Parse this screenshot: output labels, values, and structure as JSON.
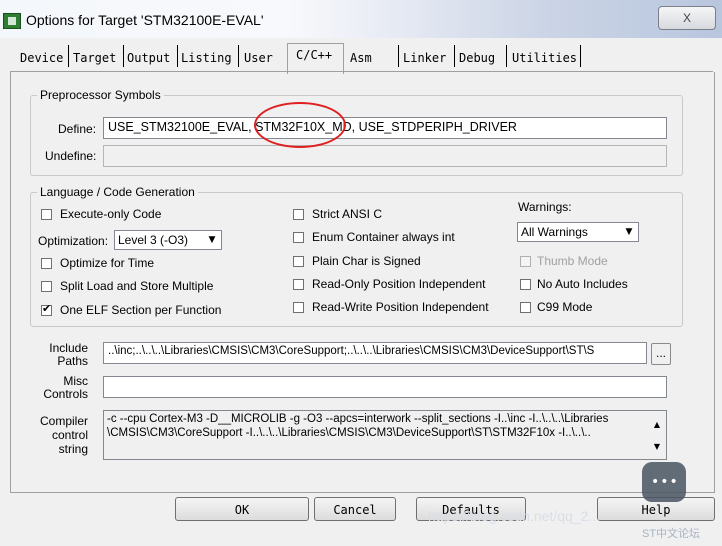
{
  "window": {
    "title": "Options for Target 'STM32100E-EVAL'",
    "close_label": "X"
  },
  "tabs": [
    "Device",
    "Target",
    "Output",
    "Listing",
    "User",
    "C/C++",
    "Asm",
    "Linker",
    "Debug",
    "Utilities"
  ],
  "active_tab": "C/C++",
  "preprocessor": {
    "legend": "Preprocessor Symbols",
    "define_label": "Define:",
    "define_value": "USE_STM32100E_EVAL, STM32F10X_MD, USE_STDPERIPH_DRIVER",
    "undefine_label": "Undefine:",
    "undefine_value": ""
  },
  "language": {
    "legend": "Language / Code Generation",
    "execute_only": "Execute-only Code",
    "optimization_label": "Optimization:",
    "optimization_value": "Level 3 (-O3)",
    "optimize_time": "Optimize for Time",
    "split_load": "Split Load and Store Multiple",
    "one_elf": "One ELF Section per Function",
    "strict_ansi": "Strict ANSI C",
    "enum_container": "Enum Container always int",
    "plain_char": "Plain Char is Signed",
    "ropi": "Read-Only Position Independent",
    "rwpi": "Read-Write Position Independent",
    "warnings_label": "Warnings:",
    "warnings_value": "All Warnings",
    "thumb_mode": "Thumb Mode",
    "no_auto_includes": "No Auto Includes",
    "c99_mode": "C99 Mode"
  },
  "include_paths": {
    "label": "Include Paths",
    "value": "..\\inc;..\\..\\..\\Libraries\\CMSIS\\CM3\\CoreSupport;..\\..\\..\\Libraries\\CMSIS\\CM3\\DeviceSupport\\ST\\S",
    "browse_label": "..."
  },
  "misc_controls": {
    "label": "Misc Controls",
    "value": ""
  },
  "compiler": {
    "label": "Compiler control string",
    "line1": "-c --cpu Cortex-M3 -D__MICROLIB -g -O3 --apcs=interwork --split_sections -I..\\inc -I..\\..\\..\\Libraries",
    "line2": "\\CMSIS\\CM3\\CoreSupport -I..\\..\\..\\Libraries\\CMSIS\\CM3\\DeviceSupport\\ST\\STM32F10x -I..\\..\\.."
  },
  "buttons": {
    "ok": "OK",
    "cancel": "Cancel",
    "defaults": "Defaults",
    "help": "Help"
  },
  "watermark": {
    "url": "https://blog.csdn.net/qq_2...",
    "site": "ST中文论坛"
  }
}
